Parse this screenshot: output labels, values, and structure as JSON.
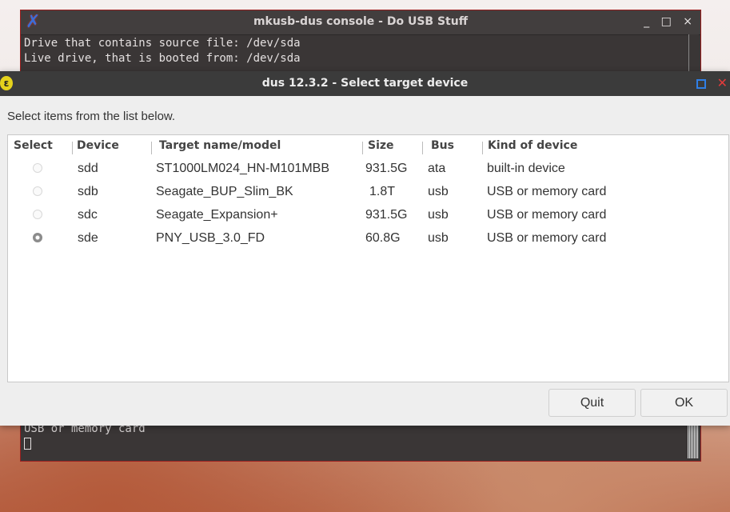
{
  "terminal": {
    "title": "mkusb-dus console - Do USB Stuff",
    "lines": [
      "Drive that contains source file: /dev/sda",
      "Live drive, that is booted from: /dev/sda"
    ],
    "bottom_line": "USB or memory card",
    "controls": {
      "minimize": "_",
      "maximize": "□",
      "close": "×"
    }
  },
  "dialog": {
    "title": "dus 12.3.2 - Select target device",
    "prompt": "Select items from the list below.",
    "columns": [
      "Select",
      "Device",
      "Target name/model",
      "Size",
      "Bus",
      "Kind of device"
    ],
    "rows": [
      {
        "selected": false,
        "device": "sdd",
        "model": "ST1000LM024_HN-M101MBB",
        "size": "931.5G",
        "bus": "ata",
        "kind": "built-in device"
      },
      {
        "selected": false,
        "device": "sdb",
        "model": "Seagate_BUP_Slim_BK",
        "size": "1.8T",
        "bus": "usb",
        "kind": "USB or memory card"
      },
      {
        "selected": false,
        "device": "sdc",
        "model": "Seagate_Expansion+",
        "size": "931.5G",
        "bus": "usb",
        "kind": "USB or memory card"
      },
      {
        "selected": true,
        "device": "sde",
        "model": "PNY_USB_3.0_FD",
        "size": "60.8G",
        "bus": "usb",
        "kind": "USB or memory card"
      }
    ],
    "buttons": {
      "quit": "Quit",
      "ok": "OK"
    }
  }
}
